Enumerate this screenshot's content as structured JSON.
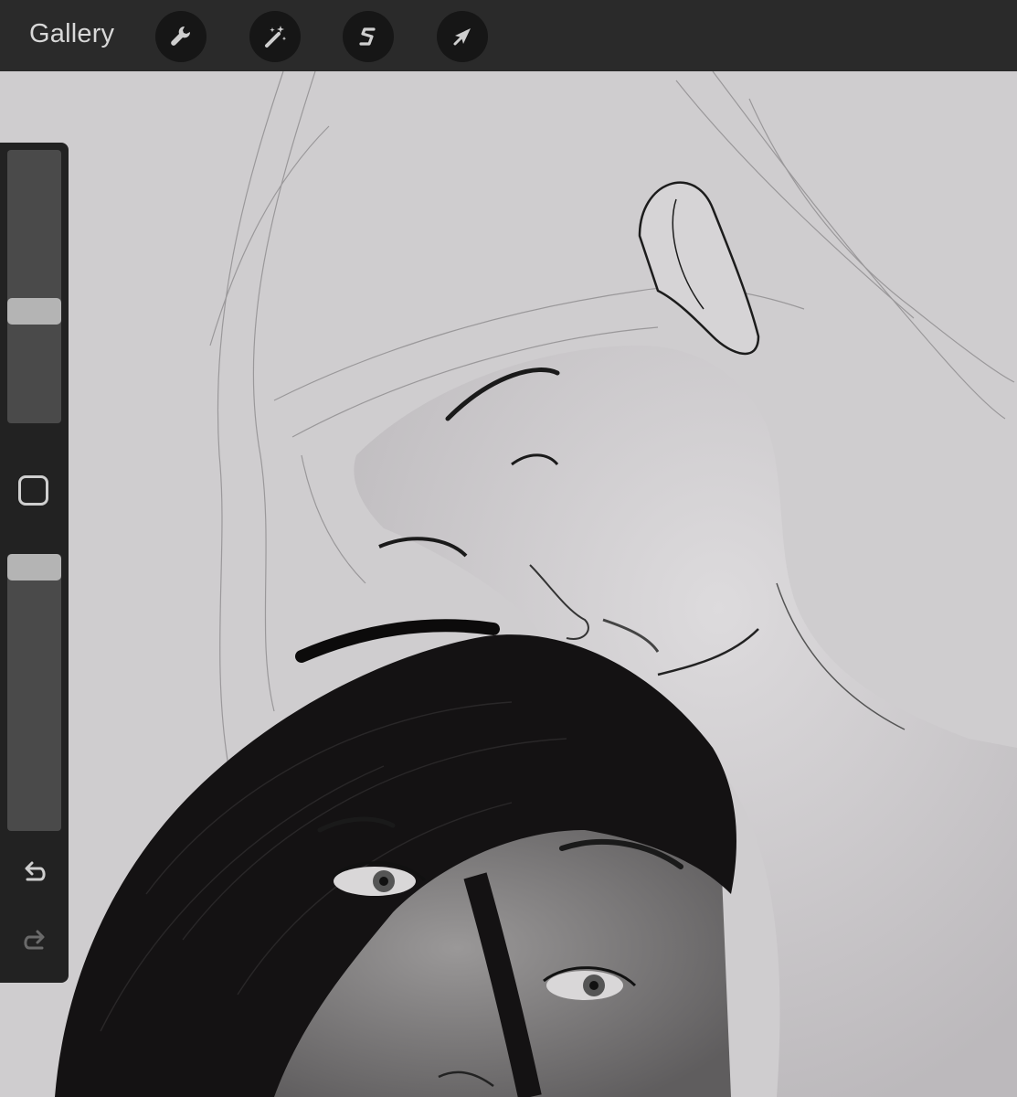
{
  "toolbar": {
    "gallery_label": "Gallery",
    "tools": [
      {
        "icon": "wrench-icon",
        "name": "actions"
      },
      {
        "icon": "magic-wand-icon",
        "name": "adjustments"
      },
      {
        "icon": "selection-s-icon",
        "name": "selection"
      },
      {
        "icon": "arrow-cursor-icon",
        "name": "transform"
      }
    ]
  },
  "sidebar": {
    "brush_size_level": 0.4,
    "brush_opacity_level": 1.0,
    "modify_button_icon": "square-outline-icon",
    "undo_icon": "undo-arrow-icon",
    "redo_icon": "redo-arrow-icon"
  },
  "colors": {
    "toolbar_bg": "#2a2a2a",
    "canvas_bg": "#cfcdcf",
    "sidebar_bg": "#222222",
    "slider_thumb": "#b4b4b4"
  }
}
